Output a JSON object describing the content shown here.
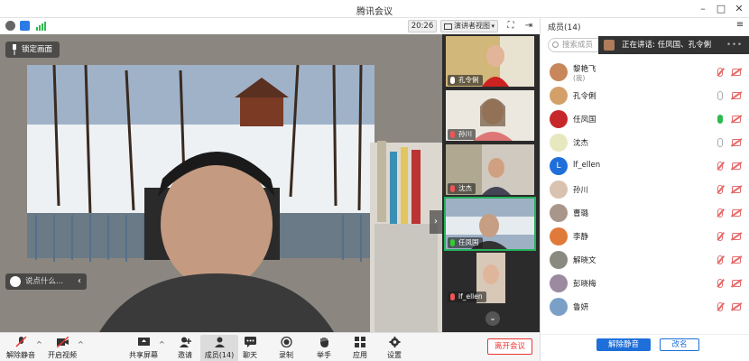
{
  "window": {
    "title": "腾讯会议"
  },
  "toolbar": {
    "time": "20:26",
    "view_label": "演讲者视图"
  },
  "main": {
    "lock_label": "锁定画面",
    "chat_placeholder": "说点什么..."
  },
  "thumbnails": [
    {
      "name": "孔令俐",
      "mic": "on"
    },
    {
      "name": "孙川",
      "mic": "muted"
    },
    {
      "name": "沈杰",
      "mic": "muted"
    },
    {
      "name": "任凤国",
      "mic": "green",
      "active": true
    },
    {
      "name": "lf_ellen",
      "mic": "muted"
    }
  ],
  "panel": {
    "title": "成员(14)",
    "search_placeholder": "搜索成员",
    "speaking": "正在讲话: 任凤国、孔令俐",
    "members": [
      {
        "name": "黎艳飞",
        "sub": "(我)",
        "mic": "muted"
      },
      {
        "name": "孔令俐",
        "sub": "",
        "mic": "gray"
      },
      {
        "name": "任凤国",
        "sub": "",
        "mic": "green"
      },
      {
        "name": "沈杰",
        "sub": "",
        "mic": "gray"
      },
      {
        "name": "lf_ellen",
        "sub": "",
        "mic": "muted",
        "letter": "L"
      },
      {
        "name": "孙川",
        "sub": "",
        "mic": "muted"
      },
      {
        "name": "曹璐",
        "sub": "",
        "mic": "muted"
      },
      {
        "name": "李静",
        "sub": "",
        "mic": "muted"
      },
      {
        "name": "解晓文",
        "sub": "",
        "mic": "muted"
      },
      {
        "name": "彭晓梅",
        "sub": "",
        "mic": "muted"
      },
      {
        "name": "鲁妍",
        "sub": "",
        "mic": "muted"
      }
    ],
    "unmute_all": "解除静音",
    "rename": "改名"
  },
  "bottom": {
    "unmute": "解除静音",
    "video": "开启视频",
    "share": "共享屏幕",
    "invite": "邀请",
    "members": "成员(14)",
    "chat": "聊天",
    "record": "录制",
    "raise_hand": "举手",
    "apps": "应用",
    "settings": "设置",
    "leave": "离开会议"
  },
  "colors": {
    "accent": "#1e6fd9",
    "muted_red": "#e56a6a",
    "speaking_green": "#2dbb4f",
    "leave_red": "#ee3333"
  }
}
